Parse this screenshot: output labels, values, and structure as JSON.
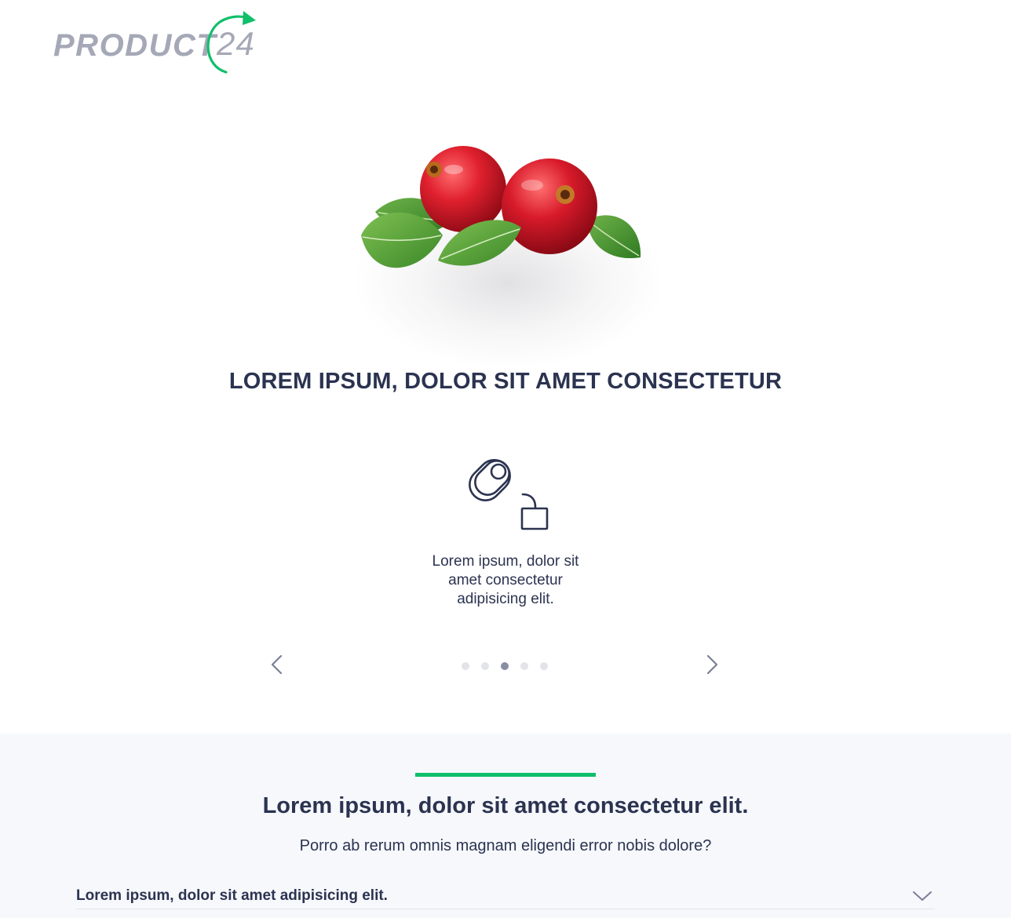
{
  "logo": {
    "word": "PRODUCT",
    "number": "24",
    "accent_color": "#10bf6a"
  },
  "hero": {
    "image": "cranberries-with-leaves",
    "headline": "LOREM IPSUM, DOLOR SIT AMET CONSECTETUR"
  },
  "carousel": {
    "step_icon": "pill-drop-into-box-icon",
    "step_text_line1": "Lorem ipsum, dolor sit",
    "step_text_line2": "amet consectetur",
    "step_text_line3": "adipisicing elit.",
    "prev_icon": "chevron-left-icon",
    "next_icon": "chevron-right-icon",
    "dots_total": 5,
    "active_dot": 3
  },
  "section": {
    "accent_color": "#10bf6a",
    "title": "Lorem ipsum, dolor sit amet consectetur elit.",
    "subtitle": "Porro ab rerum omnis magnam eligendi error nobis dolore?"
  },
  "faq": {
    "items": [
      {
        "question": "Lorem ipsum, dolor sit amet adipisicing elit.",
        "icon": "chevron-down-icon"
      }
    ]
  }
}
